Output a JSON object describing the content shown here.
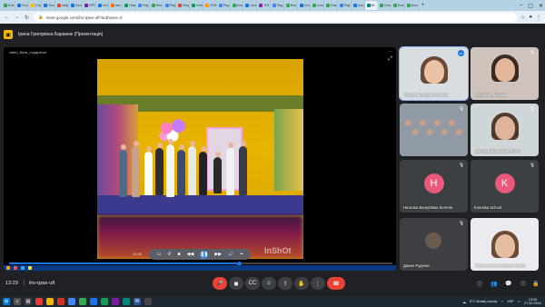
{
  "browser": {
    "tabs": [
      {
        "label": "Бла",
        "color": "#34a853"
      },
      {
        "label": "Goo",
        "color": "#1a73e8"
      },
      {
        "label": "Стр",
        "color": "#fbbc04"
      },
      {
        "label": "Goo",
        "color": "#1a73e8"
      },
      {
        "label": "Кафі",
        "color": "#ea4335"
      },
      {
        "label": "Goo",
        "color": "#1a73e8"
      },
      {
        "label": "ОРТ",
        "color": "#7b1fa2"
      },
      {
        "label": "Goo",
        "color": "#1a73e8"
      },
      {
        "label": "вікі",
        "color": "#ff6d00"
      },
      {
        "label": "Новк",
        "color": "#0f9d58"
      },
      {
        "label": "Ред",
        "color": "#4285f4"
      },
      {
        "label": "Бла",
        "color": "#34a853"
      },
      {
        "label": "Ред",
        "color": "#4285f4"
      },
      {
        "label": "Вход",
        "color": "#db4437"
      },
      {
        "label": "Нова",
        "color": "#0f9d58"
      },
      {
        "label": "3ОН",
        "color": "#ff9800"
      },
      {
        "label": "Ред",
        "color": "#4285f4"
      },
      {
        "label": "Бла",
        "color": "#34a853"
      },
      {
        "label": "Goo",
        "color": "#1a73e8"
      },
      {
        "label": "ТІЯ",
        "color": "#8e24aa"
      },
      {
        "label": "Ред",
        "color": "#4285f4"
      },
      {
        "label": "Бла",
        "color": "#34a853"
      },
      {
        "label": "Goo",
        "color": "#1a73e8"
      },
      {
        "label": "Бла",
        "color": "#34a853"
      },
      {
        "label": "Бла",
        "color": "#34a853"
      },
      {
        "label": "Ред",
        "color": "#4285f4"
      },
      {
        "label": "Goo",
        "color": "#1a73e8"
      },
      {
        "label": "Mr",
        "color": "#00897b",
        "active": true
      },
      {
        "label": "Бла",
        "color": "#34a853"
      },
      {
        "label": "Бла",
        "color": "#34a853"
      },
      {
        "label": "Бла",
        "color": "#34a853"
      }
    ],
    "new_tab": "+",
    "url": "meet.google.com/iho-tpwx-ufl?authuser=0"
  },
  "meet": {
    "presenter_title": "Ірина Григорівна Баранюк (Презентація)",
    "stage_caption": "video_Катя_студентка",
    "video": {
      "timecode": "15:46",
      "watermark": "InShOt",
      "progress_fraction": 0.6
    },
    "participants": [
      {
        "name": "Ірина Григорівна Баранюк",
        "type": "video",
        "speaking": true
      },
      {
        "name": "Катерина Лисевміч",
        "type": "video"
      },
      {
        "name": "",
        "type": "video"
      },
      {
        "name": "Світлана Василівна Ридуп",
        "type": "video"
      },
      {
        "name": "Наталка Валеріївна Котелін",
        "type": "avatar",
        "initial": "Н"
      },
      {
        "name": "Kosovka School",
        "type": "avatar",
        "initial": "K"
      },
      {
        "name": "Данил Руденко",
        "type": "video"
      },
      {
        "name": "Тетяна Олександрівна Прийо",
        "type": "video"
      }
    ],
    "bottom": {
      "time": "13:29",
      "meeting_code": "iho-tpwx-ufl"
    }
  },
  "taskbar": {
    "weather": "5°C  Mostly cloudy",
    "lang": "УКР",
    "time": "13:29",
    "date": "27.02.2024"
  }
}
